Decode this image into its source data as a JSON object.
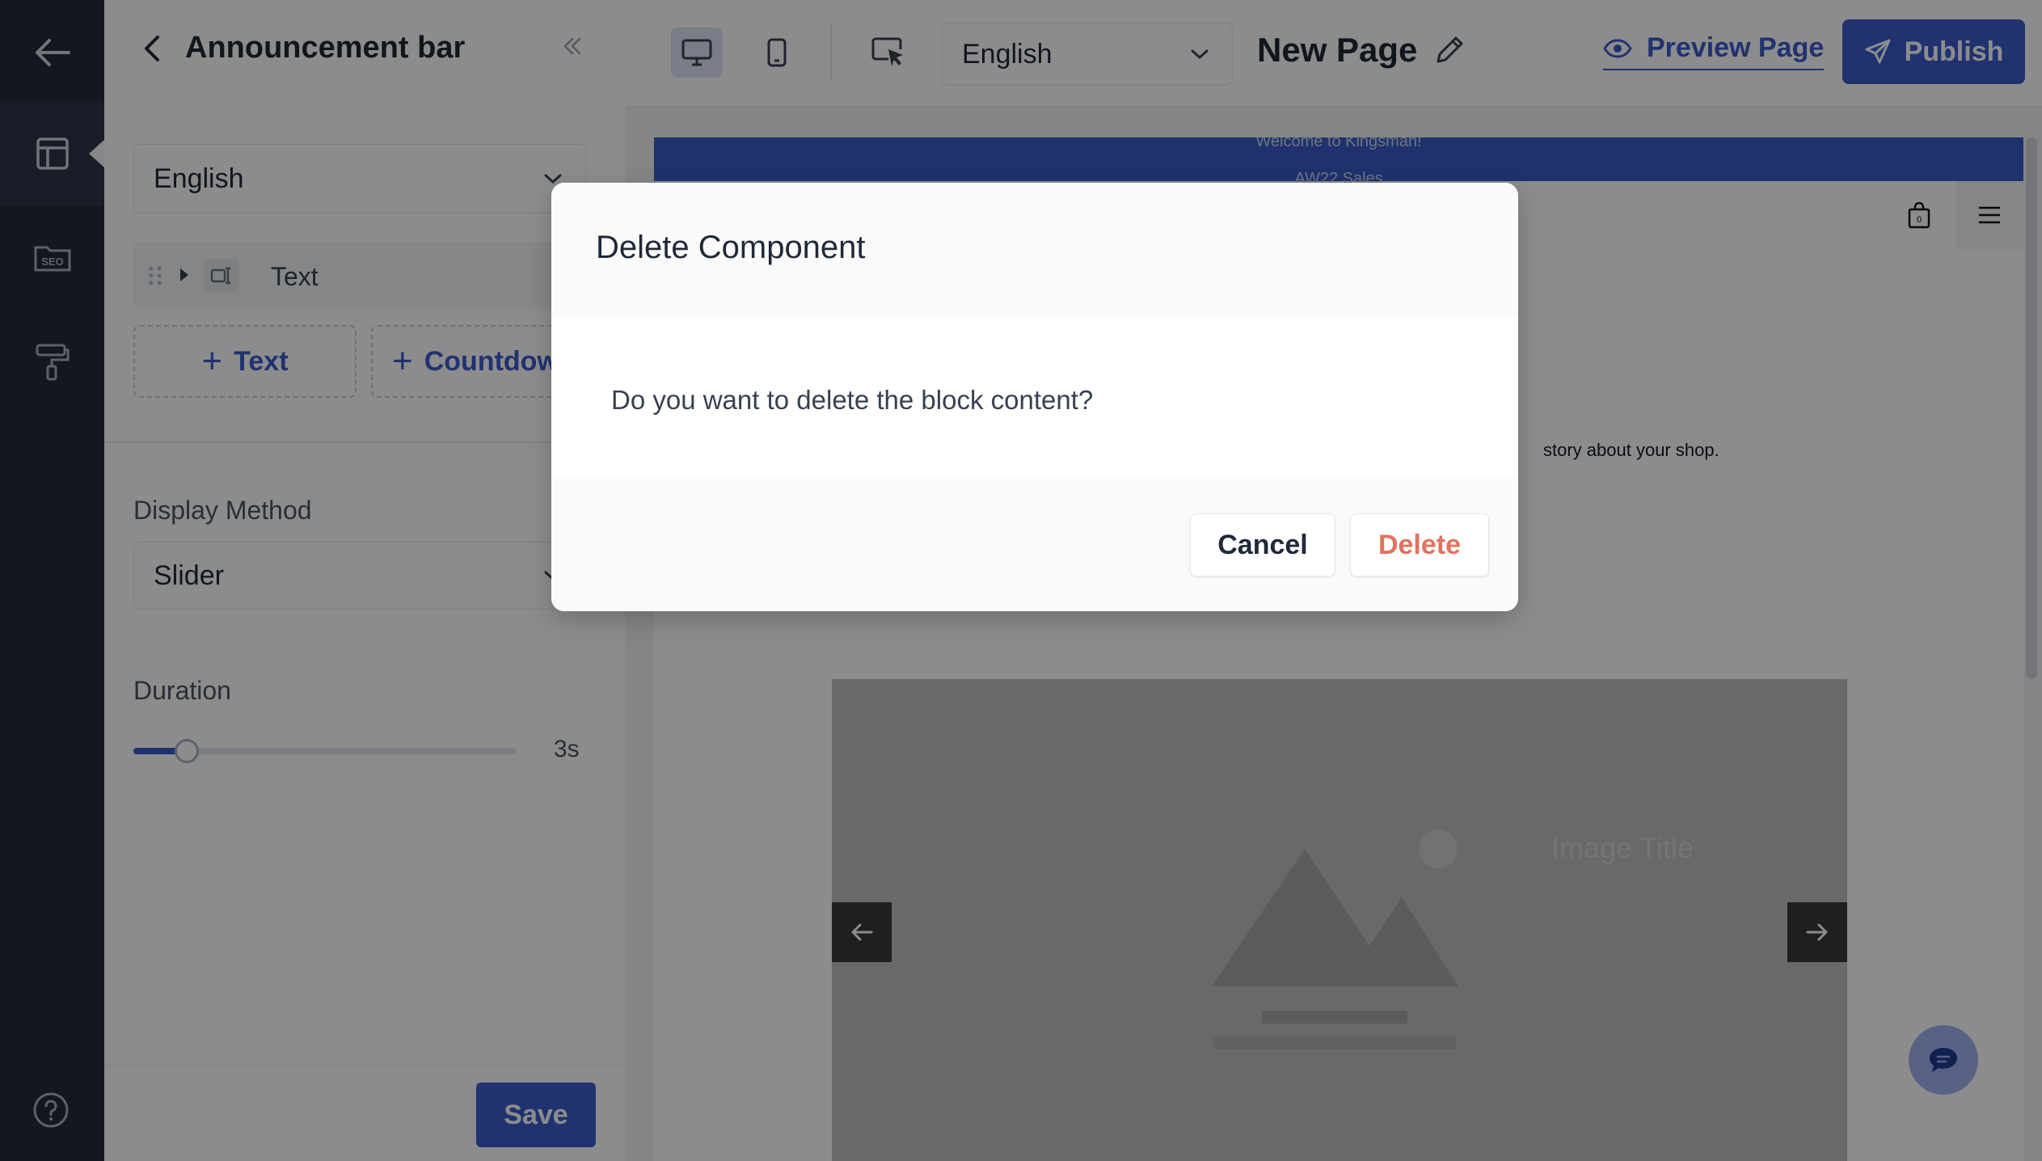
{
  "panel": {
    "title": "Announcement bar",
    "language": "English",
    "block_item": "Text",
    "add_buttons": [
      "Text",
      "Countdown"
    ],
    "display_method_label": "Display Method",
    "display_method_value": "Slider",
    "duration_label": "Duration",
    "duration_value": "3s",
    "duration_fraction": 0.14,
    "save_label": "Save"
  },
  "toolbar": {
    "language": "English",
    "page_title": "New Page",
    "preview_label": "Preview Page",
    "publish_label": "Publish"
  },
  "site": {
    "announcement_lines": [
      "Welcome to Kingsman!",
      "AW22 Sales"
    ],
    "cart_count": "0",
    "story_text": "story about your shop.",
    "hero_title": "Image Title"
  },
  "modal": {
    "title": "Delete Component",
    "message": "Do you want to delete the block content?",
    "cancel_label": "Cancel",
    "delete_label": "Delete"
  },
  "colors": {
    "accent": "#3b5ccc",
    "rail": "#232a3b",
    "danger_text": "#e0735f"
  }
}
